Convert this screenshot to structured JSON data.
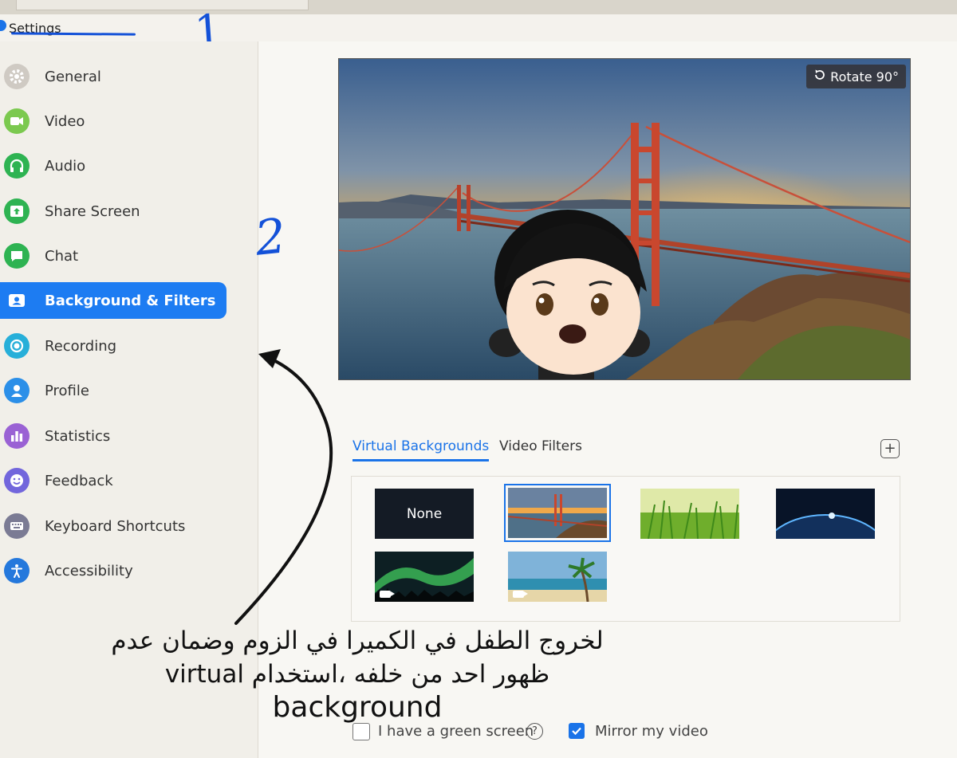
{
  "window": {
    "title": "Settings"
  },
  "annotations": {
    "step1": "1",
    "step2": "2",
    "note_line1": "لخروج الطفل في الكميرا في الزوم وضمان عدم",
    "note_line2": "ظهور احد من خلفه ،استخدام virtual",
    "note_line3": "background"
  },
  "sidebar": {
    "items": [
      {
        "label": "General",
        "icon": "gear-icon",
        "color": "#9a9590"
      },
      {
        "label": "Video",
        "icon": "video-camera-icon",
        "color": "#53b535"
      },
      {
        "label": "Audio",
        "icon": "headphones-icon",
        "color": "#2aa94a"
      },
      {
        "label": "Share Screen",
        "icon": "share-screen-icon",
        "color": "#2aa94a"
      },
      {
        "label": "Chat",
        "icon": "chat-bubble-icon",
        "color": "#2aa94a"
      },
      {
        "label": "Background & Filters",
        "icon": "person-card-icon",
        "color": "#ffffff",
        "active": true
      },
      {
        "label": "Recording",
        "icon": "record-circle-icon",
        "color": "#20a8d8"
      },
      {
        "label": "Profile",
        "icon": "profile-person-icon",
        "color": "#1d86e0"
      },
      {
        "label": "Statistics",
        "icon": "bar-chart-icon",
        "color": "#8a4fc6"
      },
      {
        "label": "Feedback",
        "icon": "smiley-icon",
        "color": "#6b60d6"
      },
      {
        "label": "Keyboard Shortcuts",
        "icon": "keyboard-icon",
        "color": "#6e6e8a"
      },
      {
        "label": "Accessibility",
        "icon": "accessibility-icon",
        "color": "#1d6fd6"
      }
    ]
  },
  "preview": {
    "rotate_label": "Rotate 90°"
  },
  "tabs": [
    {
      "label": "Virtual Backgrounds",
      "active": true
    },
    {
      "label": "Video Filters",
      "active": false
    }
  ],
  "add_button": "+",
  "backgrounds": [
    {
      "label": "None",
      "kind": "none"
    },
    {
      "kind": "golden-gate",
      "selected": true
    },
    {
      "kind": "grass"
    },
    {
      "kind": "earth-from-space"
    },
    {
      "kind": "aurora",
      "video": true
    },
    {
      "kind": "beach",
      "video": true
    }
  ],
  "options": {
    "green_screen_label": "I have a green screen",
    "green_screen_checked": false,
    "help_mark": "?",
    "mirror_label": "Mirror my video",
    "mirror_checked": true
  },
  "colors": {
    "accent": "#1a73e8",
    "annotation_blue": "#1351d8"
  }
}
